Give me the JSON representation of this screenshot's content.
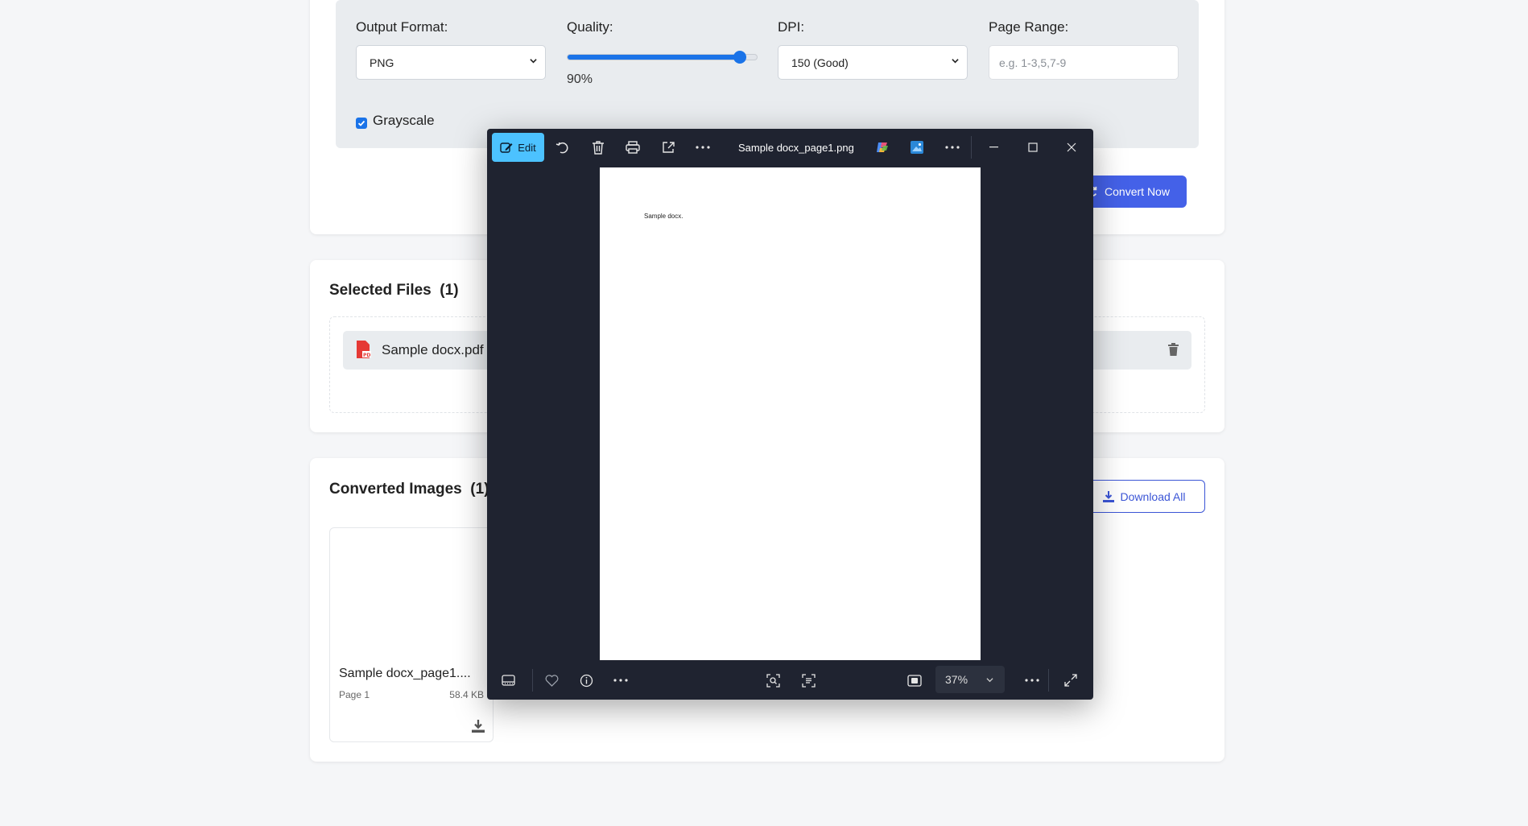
{
  "options": {
    "output_format_label": "Output Format:",
    "output_format_value": "PNG",
    "quality_label": "Quality:",
    "quality_value": "90%",
    "quality_fraction": 0.9,
    "dpi_label": "DPI:",
    "dpi_value": "150 (Good)",
    "page_range_label": "Page Range:",
    "page_range_placeholder": "e.g. 1-3,5,7-9",
    "grayscale_label": "Grayscale",
    "grayscale_checked": true,
    "convert_button": "Convert Now"
  },
  "selected_files": {
    "title": "Selected Files",
    "count": "(1)",
    "files": [
      {
        "name": "Sample docx.pdf"
      }
    ]
  },
  "converted_images": {
    "title": "Converted Images",
    "count": "(1)",
    "download_all": "Download All",
    "images": [
      {
        "name": "Sample docx_page1....",
        "page": "Page 1",
        "size": "58.4 KB"
      }
    ]
  },
  "viewer": {
    "edit_label": "Edit",
    "file_name": "Sample docx_page1.png",
    "page_text": "Sample docx.",
    "zoom": "37%"
  },
  "colors": {
    "accent": "#4461e8",
    "slider": "#1a73e8",
    "viewer_bg": "#1f2330",
    "edit_button": "#4cc2ff",
    "pdf_icon": "#e53935"
  }
}
